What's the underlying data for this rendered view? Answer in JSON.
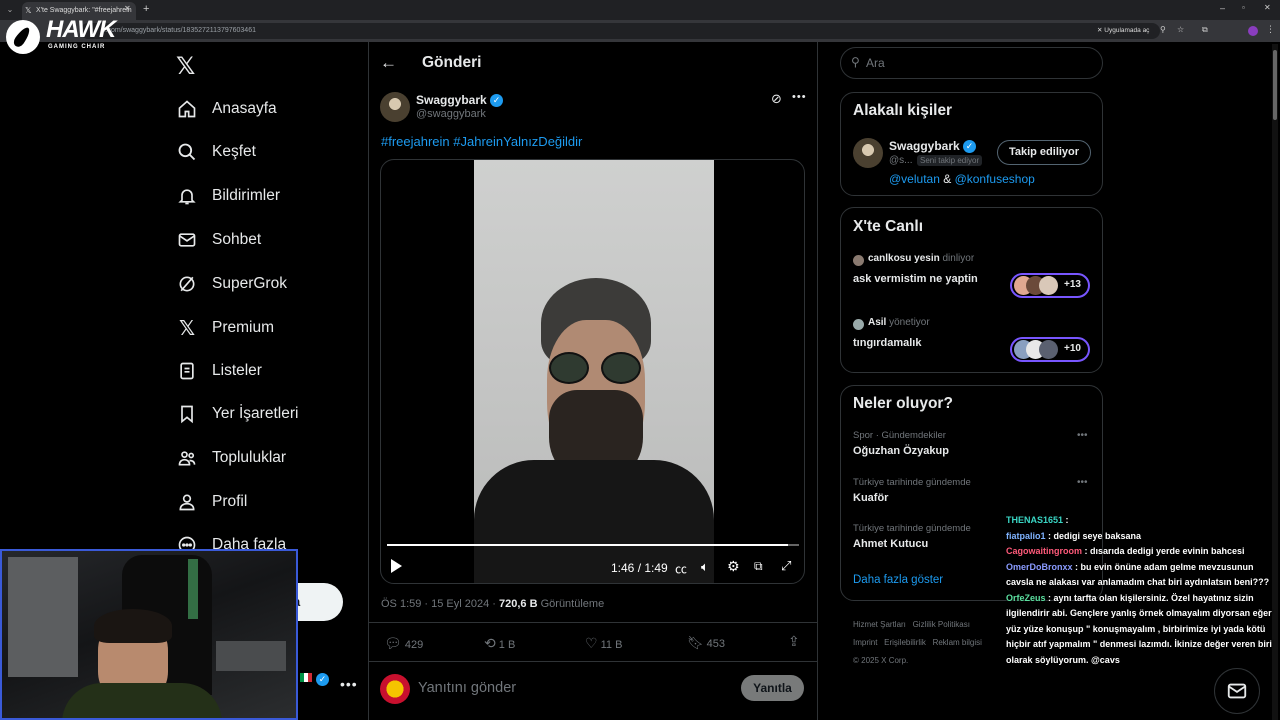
{
  "browser": {
    "tab_title": "X'te Swaggybark: \"#freejahrein",
    "url": "x.com/swaggybark/status/1835272113797603461",
    "app_prompt": "Uygulamada aç"
  },
  "overlay": {
    "brand": "HAWK",
    "brand_sub": "GAMING CHAIR"
  },
  "nav": {
    "items": [
      "Anasayfa",
      "Keşfet",
      "Bildirimler",
      "Sohbet",
      "SuperGrok",
      "Premium",
      "Listeler",
      "Yer İşaretleri",
      "Topluluklar",
      "Profil",
      "Daha fazla"
    ],
    "post_button_partial": "a"
  },
  "post": {
    "header": "Gönderi",
    "author_name": "Swaggybark",
    "author_handle": "@swaggybark",
    "text": "#freejahrein #JahreinYalnızDeğildir",
    "video_time": "1:46 / 1:49",
    "video_progress": 0.973,
    "timestamp": "ÖS 1:59 · 15 Eyl 2024 · ",
    "views_count": "720,6 B",
    "views_label": " Görüntüleme",
    "replies": "429",
    "reposts": "1 B",
    "likes": "11 B",
    "bookmarks": "453",
    "reply_placeholder": "Yanıtını gönder",
    "reply_button": "Yanıtla"
  },
  "search": {
    "placeholder": "Ara"
  },
  "relevant": {
    "title": "Alakalı kişiler",
    "name": "Swaggybark",
    "handle": "@s...",
    "follows_you": "Seni takip ediyor",
    "follow_button": "Takip ediliyor",
    "mention1": "@velutan",
    "amp": " & ",
    "mention2": "@konfuseshop"
  },
  "live": {
    "title": "X'te Canlı",
    "items": [
      {
        "host": "canlkosu yesin",
        "role": "dinliyor",
        "title": "ask vermistim ne yaptin",
        "count": "+13"
      },
      {
        "host": "Asil",
        "role": "yönetiyor",
        "title": "tıngırdamalık",
        "count": "+10"
      }
    ]
  },
  "trends": {
    "title": "Neler oluyor?",
    "items": [
      {
        "context": "Spor · Gündemdekiler",
        "name": "Oğuzhan Özyakup"
      },
      {
        "context": "Türkiye tarihinde gündemde",
        "name": "Kuaför"
      },
      {
        "context": "Türkiye tarihinde gündemde",
        "name": "Ahmet Kutucu"
      }
    ],
    "more": "Daha fazla göster"
  },
  "footer": {
    "links": [
      "Hizmet Şartları",
      "Gizlilik Politikası",
      "Imprint",
      "Erişilebilirlik",
      "Reklam bilgisi",
      "Daha fazla ..."
    ],
    "copyright": "© 2025 X Corp."
  },
  "chat": [
    {
      "user": "THENAS1651",
      "user_color": "#3ad6c5",
      "msg": " : "
    },
    {
      "user": "fiatpalio1",
      "user_color": "#7fb3ff",
      "msg": " : dedigi seye baksana"
    },
    {
      "user": "Cagowaitingroom",
      "user_color": "#ff5a7a",
      "msg": " : dısarıda dedigi yerde evinin bahcesi"
    },
    {
      "user": "OmerDoBronxx",
      "user_color": "#8a9bff",
      "msg": " : bu evin önüne adam gelme mevzusunun"
    },
    {
      "user": "",
      "user_color": "#fff",
      "msg": "cavsla ne alakası var anlamadım chat biri aydınlatsın beni???"
    },
    {
      "user": "OrfeZeus",
      "user_color": "#5ce0a0",
      "msg": " : aynı tarfta olan kişilersiniz. Özel hayatınız sizin"
    },
    {
      "user": "",
      "user_color": "#fff",
      "msg": "ilgilendirir abi. Gençlere yanlış örnek olmayalım diyorsan eğer"
    },
    {
      "user": "",
      "user_color": "#fff",
      "msg": "yüz yüze konuşup \" konuşmayalım , birbirimize iyi yada kötü"
    },
    {
      "user": "",
      "user_color": "#fff",
      "msg": "hiçbir atıf yapmalım \" denmesi lazımdı. İkinize değer veren biri"
    },
    {
      "user": "",
      "user_color": "#fff",
      "msg": "olarak söylüyorum. @cavs"
    }
  ]
}
